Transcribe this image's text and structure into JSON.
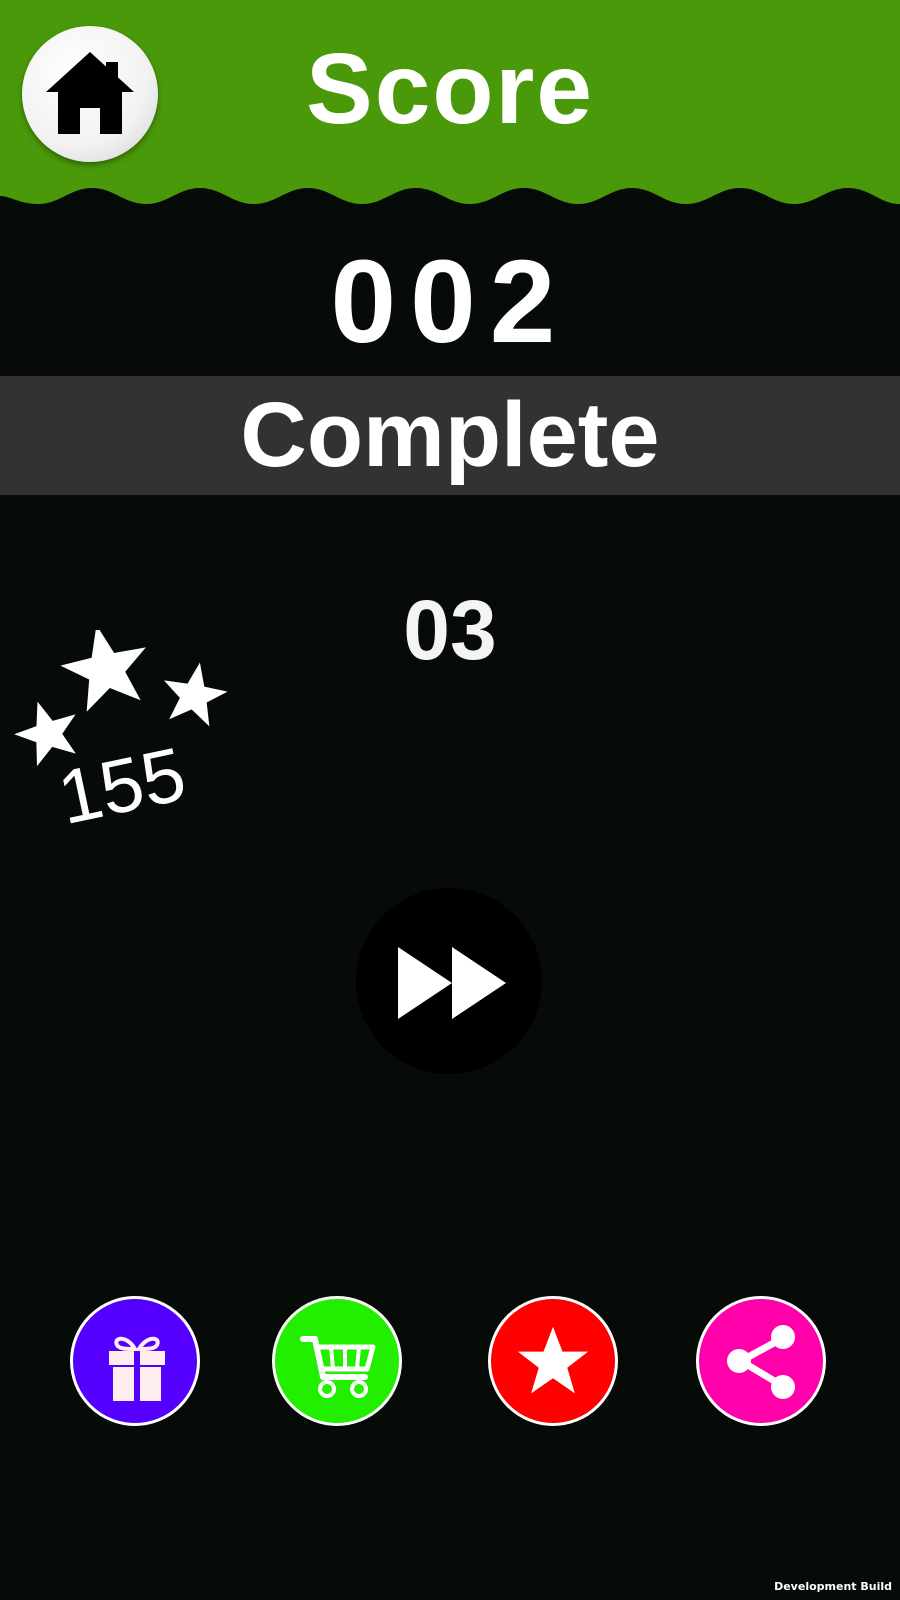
{
  "header": {
    "title": "Score",
    "color": "#4a990a",
    "home_button": {
      "icon": "home-icon"
    }
  },
  "result": {
    "score": "002",
    "status": "Complete",
    "level": "03"
  },
  "stars": {
    "icon": "stars-icon",
    "count": "155"
  },
  "actions": {
    "next": {
      "icon": "fast-forward-icon"
    },
    "buttons": [
      {
        "id": "gift",
        "icon": "gift-icon",
        "color": "#5500ff"
      },
      {
        "id": "shop",
        "icon": "cart-icon",
        "color": "#22ee00"
      },
      {
        "id": "rate",
        "icon": "star-icon",
        "color": "#ff0000"
      },
      {
        "id": "share",
        "icon": "share-icon",
        "color": "#ff00aa"
      }
    ]
  },
  "footer": {
    "build_label": "Development Build"
  }
}
